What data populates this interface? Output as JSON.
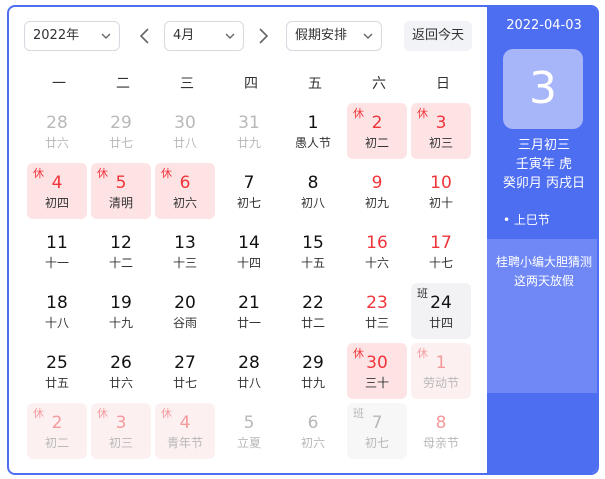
{
  "toolbar": {
    "year_value": "2022年",
    "month_value": "4月",
    "holiday_value": "假期安排",
    "today_label": "返回今天"
  },
  "weekdays": [
    "一",
    "二",
    "三",
    "四",
    "五",
    "六",
    "日"
  ],
  "days": [
    {
      "num": "28",
      "lunar": "廿六",
      "style": "muted"
    },
    {
      "num": "29",
      "lunar": "廿七",
      "style": "muted"
    },
    {
      "num": "30",
      "lunar": "廿八",
      "style": "muted"
    },
    {
      "num": "31",
      "lunar": "廿九",
      "style": "muted"
    },
    {
      "num": "1",
      "lunar": "愚人节",
      "style": ""
    },
    {
      "num": "2",
      "lunar": "初二",
      "style": "rest",
      "tag": "休"
    },
    {
      "num": "3",
      "lunar": "初三",
      "style": "rest",
      "tag": "休"
    },
    {
      "num": "4",
      "lunar": "初四",
      "style": "rest",
      "tag": "休"
    },
    {
      "num": "5",
      "lunar": "清明",
      "style": "rest",
      "tag": "休"
    },
    {
      "num": "6",
      "lunar": "初六",
      "style": "rest",
      "tag": "休"
    },
    {
      "num": "7",
      "lunar": "初七",
      "style": ""
    },
    {
      "num": "8",
      "lunar": "初八",
      "style": ""
    },
    {
      "num": "9",
      "lunar": "初九",
      "style": "weekend"
    },
    {
      "num": "10",
      "lunar": "初十",
      "style": "weekend"
    },
    {
      "num": "11",
      "lunar": "十一",
      "style": ""
    },
    {
      "num": "12",
      "lunar": "十二",
      "style": ""
    },
    {
      "num": "13",
      "lunar": "十三",
      "style": ""
    },
    {
      "num": "14",
      "lunar": "十四",
      "style": ""
    },
    {
      "num": "15",
      "lunar": "十五",
      "style": ""
    },
    {
      "num": "16",
      "lunar": "十六",
      "style": "weekend"
    },
    {
      "num": "17",
      "lunar": "十七",
      "style": "weekend"
    },
    {
      "num": "18",
      "lunar": "十八",
      "style": ""
    },
    {
      "num": "19",
      "lunar": "十九",
      "style": ""
    },
    {
      "num": "20",
      "lunar": "谷雨",
      "style": ""
    },
    {
      "num": "21",
      "lunar": "廿一",
      "style": ""
    },
    {
      "num": "22",
      "lunar": "廿二",
      "style": ""
    },
    {
      "num": "23",
      "lunar": "廿三",
      "style": "weekend"
    },
    {
      "num": "24",
      "lunar": "廿四",
      "style": "work",
      "tag": "班"
    },
    {
      "num": "25",
      "lunar": "廿五",
      "style": ""
    },
    {
      "num": "26",
      "lunar": "廿六",
      "style": ""
    },
    {
      "num": "27",
      "lunar": "廿七",
      "style": ""
    },
    {
      "num": "28",
      "lunar": "廿八",
      "style": ""
    },
    {
      "num": "29",
      "lunar": "廿九",
      "style": ""
    },
    {
      "num": "30",
      "lunar": "三十",
      "style": "rest",
      "tag": "休"
    },
    {
      "num": "1",
      "lunar": "劳动节",
      "style": "faded rest",
      "tag": "休"
    },
    {
      "num": "2",
      "lunar": "初二",
      "style": "faded rest",
      "tag": "休"
    },
    {
      "num": "3",
      "lunar": "初三",
      "style": "faded rest",
      "tag": "休"
    },
    {
      "num": "4",
      "lunar": "青年节",
      "style": "faded rest",
      "tag": "休"
    },
    {
      "num": "5",
      "lunar": "立夏",
      "style": "muted"
    },
    {
      "num": "6",
      "lunar": "初六",
      "style": "muted"
    },
    {
      "num": "7",
      "lunar": "初七",
      "style": "faded work",
      "tag": "班"
    },
    {
      "num": "8",
      "lunar": "母亲节",
      "style": "faded weekend"
    }
  ],
  "side": {
    "date": "2022-04-03",
    "day": "3",
    "lunar_date": "三月初三",
    "year_ganzhi": "壬寅年 虎",
    "month_day_ganzhi": "癸卯月 丙戌日",
    "festival": "• 上巳节",
    "promo_line1": "桂聘小编大胆猜测",
    "promo_line2": "这两天放假"
  },
  "colors": {
    "accent": "#4e6ef2",
    "holiday_red": "#f0353a",
    "rest_bg": "#fde3e4",
    "work_bg": "#f2f2f4"
  }
}
